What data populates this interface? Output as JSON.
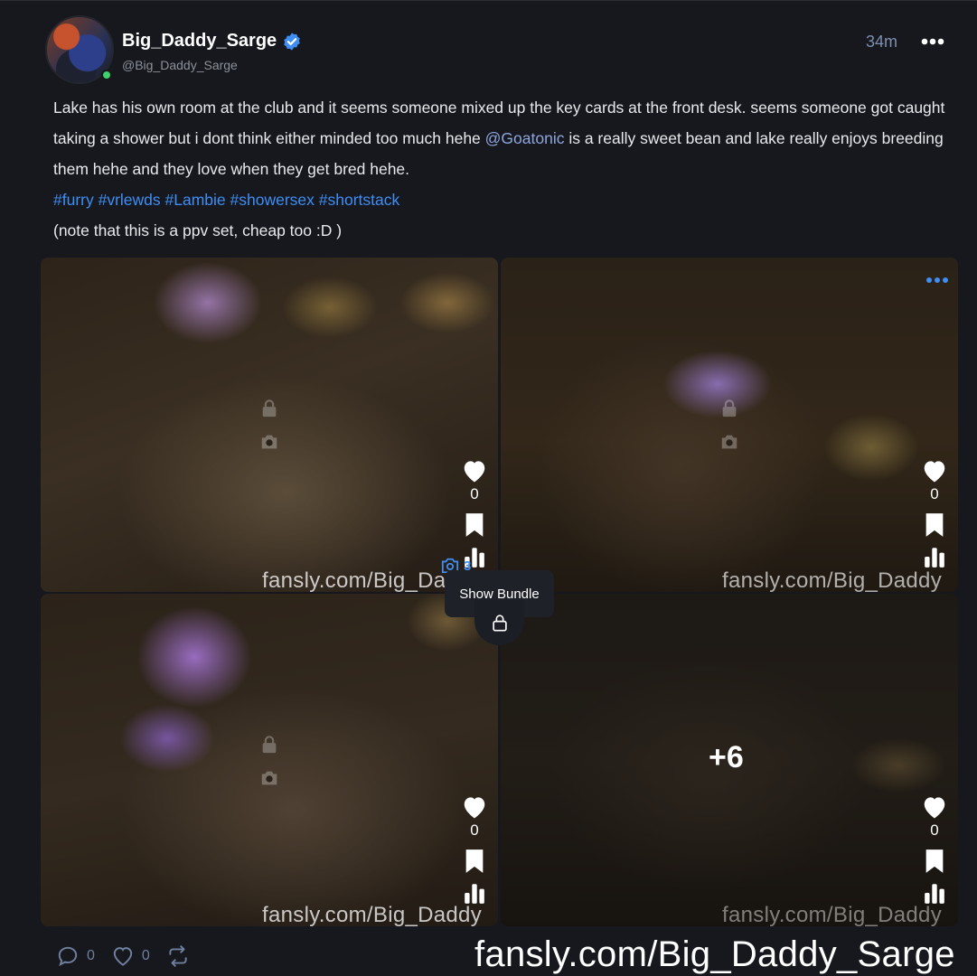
{
  "post": {
    "display_name": "Big_Daddy_Sarge",
    "username": "@Big_Daddy_Sarge",
    "time": "34m",
    "text_part1": "Lake has his own room at the club and it seems someone mixed up the key cards at the front desk. seems someone got caught taking a shower but i dont think either minded too much hehe ",
    "mention": "@Goatonic",
    "text_part2": " is a really sweet bean and lake really enjoys breeding them hehe and they love when they get bred hehe.",
    "tags": "#furry #vrlewds #Lambie #showersex #shortstack",
    "note": "(note that this is a ppv set, cheap too :D )"
  },
  "media": [
    {
      "likes": "0",
      "watermark": "fansly.com/Big_Da"
    },
    {
      "likes": "0",
      "watermark": "fansly.com/Big_Daddy"
    },
    {
      "likes": "0",
      "watermark": "fansly.com/Big_Daddy"
    },
    {
      "likes": "0",
      "watermark": "fansly.com/Big_Daddy",
      "more_count": "+6"
    }
  ],
  "bundle": {
    "count": "3",
    "tooltip": "Show Bundle"
  },
  "footer": {
    "comments": "0",
    "likes": "0"
  },
  "overlay_watermark": "fansly.com/Big_Daddy_Sarge",
  "colors": {
    "accent": "#3e8ef5",
    "mention": "#8ea6de",
    "background": "#16181d"
  },
  "icons": [
    "verified-icon",
    "more-icon",
    "lock-icon",
    "camera-icon",
    "heart-icon",
    "bookmark-icon",
    "stats-icon",
    "comment-icon",
    "repost-icon"
  ]
}
